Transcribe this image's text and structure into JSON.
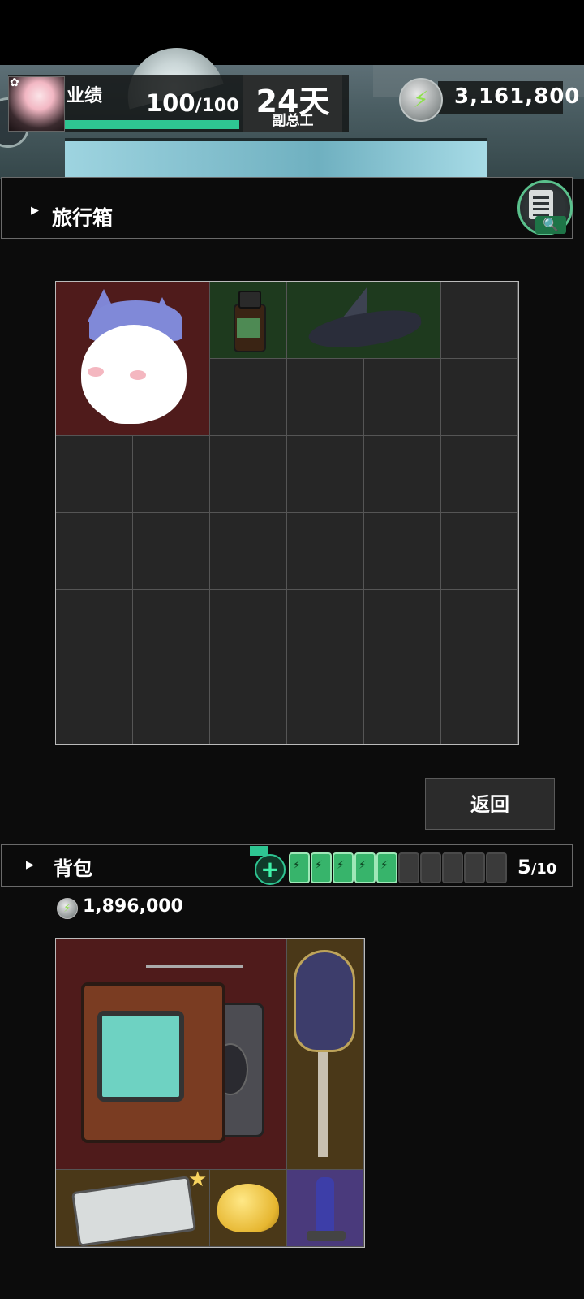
{
  "header": {
    "performance_label": "业绩",
    "performance_value": "100",
    "performance_max": "/100",
    "performance_fraction": 1.0,
    "days": "24天",
    "title": "副总工",
    "currency_top": "3,161,800"
  },
  "suitcase": {
    "title": "旅行箱",
    "grid_columns": 6,
    "grid_rows": 6,
    "items": [
      "plush-cat",
      "medicine-bottle",
      "black-crow"
    ]
  },
  "return_label": "返回",
  "backpack": {
    "title": "背包",
    "money": "1,896,000",
    "battery_current": "5",
    "battery_max": "/10",
    "battery_full": 5,
    "battery_total": 10,
    "grid_columns": 4,
    "grid_rows": 4,
    "items": [
      "retro-tv",
      "electric-guitar",
      "cassette-tape",
      "cheese-lump",
      "figurine"
    ]
  },
  "icons": {
    "coin": "lightning-coin-icon",
    "clipboard": "clipboard-search-icon",
    "expand": "triangle-right-icon"
  },
  "colors": {
    "accent_green": "#2ec592",
    "item_red_bg": "#4f1b1b",
    "item_green_bg": "#1e3a1e",
    "item_brown_bg": "#4a3818",
    "item_purple_bg": "#4a3a7c"
  }
}
